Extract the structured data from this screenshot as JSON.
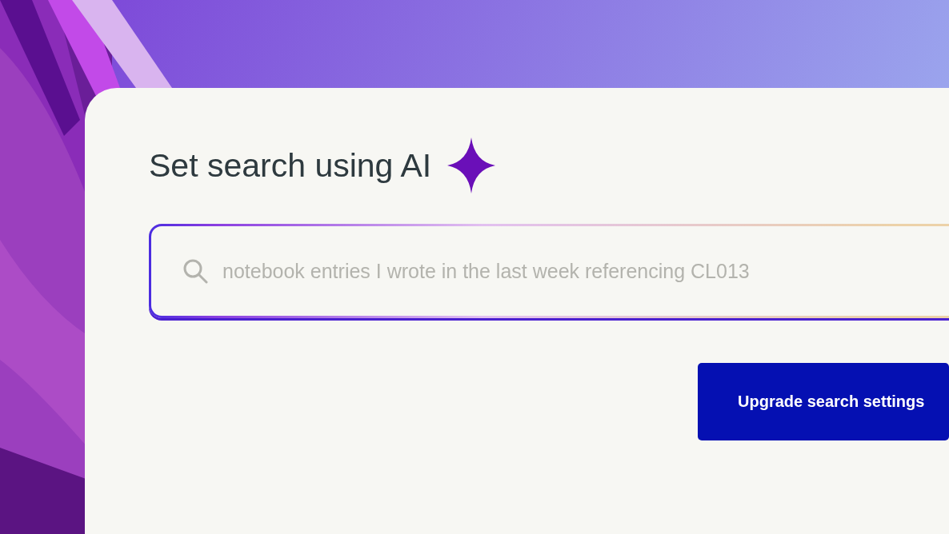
{
  "title": "Set search using AI",
  "search": {
    "placeholder": "notebook entries I wrote in the last week referencing CL013"
  },
  "buttons": [
    {
      "label": "Upgrade search settings"
    }
  ]
}
